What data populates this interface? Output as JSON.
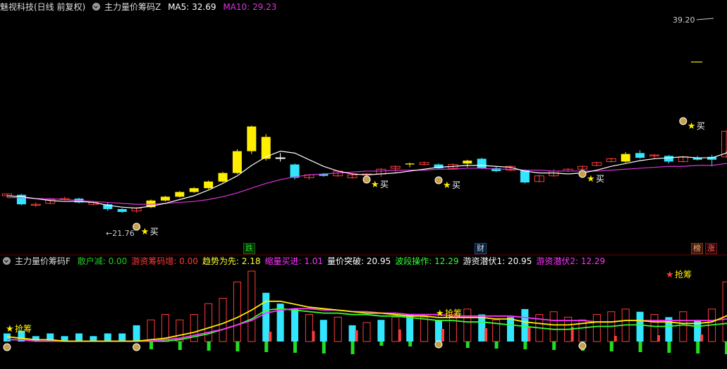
{
  "header_top": {
    "title": "魅视科技(日线 前复权)",
    "indicator": "主力量价筹码Z",
    "ma5_label": "MA5: 32.69",
    "ma10_label": "MA10: 29.23"
  },
  "header_bottom": {
    "indicator": "主力量价筹码F",
    "items": [
      {
        "label": "散户减: 0.00",
        "color": "#22cc22"
      },
      {
        "label": "游资筹码增: 0.00",
        "color": "#ff3b3b"
      },
      {
        "label": "趋势为先: 2.18",
        "color": "#ffff33"
      },
      {
        "label": "缩量买进: 1.01",
        "color": "#ff33ff"
      },
      {
        "label": "量价突破: 20.95",
        "color": "#ffffff"
      },
      {
        "label": "波段操作: 12.29",
        "color": "#33ff33"
      },
      {
        "label": "游资潜伏1: 20.95",
        "color": "#ffffff"
      },
      {
        "label": "游资潜伏2: 12.29",
        "color": "#ff33ff"
      }
    ]
  },
  "price_labels": {
    "high": "39.20",
    "low": "21.76"
  },
  "markers": {
    "buy": "买",
    "grab": "抢筹"
  },
  "tags": {
    "die": "跌",
    "cai": "财",
    "bang": "榜",
    "zhang": "涨"
  },
  "colors": {
    "up": "#ff3b3b",
    "down": "#33e6ff",
    "yellow": "#ffee00",
    "ma5": "#ffffff",
    "ma10": "#dd33dd"
  },
  "chart_data": {
    "type": "candlestick",
    "price_range": [
      19,
      42
    ],
    "candles": [
      {
        "o": 23.6,
        "h": 23.8,
        "l": 23.4,
        "c": 23.8,
        "s": "up"
      },
      {
        "o": 23.7,
        "h": 23.8,
        "l": 22.6,
        "c": 22.7,
        "s": "down"
      },
      {
        "o": 22.7,
        "h": 22.9,
        "l": 22.4,
        "c": 22.6,
        "s": "up"
      },
      {
        "o": 22.8,
        "h": 23.3,
        "l": 22.7,
        "c": 23.2,
        "s": "up"
      },
      {
        "o": 23.3,
        "h": 23.5,
        "l": 23.1,
        "c": 23.2,
        "s": "up"
      },
      {
        "o": 23.3,
        "h": 23.4,
        "l": 22.8,
        "c": 22.9,
        "s": "down"
      },
      {
        "o": 22.9,
        "h": 23.0,
        "l": 22.6,
        "c": 22.7,
        "s": "up"
      },
      {
        "o": 22.7,
        "h": 22.9,
        "l": 22.0,
        "c": 22.2,
        "s": "down"
      },
      {
        "o": 22.2,
        "h": 22.3,
        "l": 21.8,
        "c": 21.9,
        "s": "down"
      },
      {
        "o": 22.0,
        "h": 22.4,
        "l": 21.8,
        "c": 22.3,
        "s": "up"
      },
      {
        "o": 22.4,
        "h": 23.2,
        "l": 22.3,
        "c": 23.1,
        "s": "yellow"
      },
      {
        "o": 23.1,
        "h": 23.6,
        "l": 23.0,
        "c": 23.5,
        "s": "yellow"
      },
      {
        "o": 23.5,
        "h": 24.1,
        "l": 23.4,
        "c": 24.0,
        "s": "yellow"
      },
      {
        "o": 24.0,
        "h": 24.5,
        "l": 23.9,
        "c": 24.4,
        "s": "yellow"
      },
      {
        "o": 24.4,
        "h": 25.2,
        "l": 24.3,
        "c": 25.1,
        "s": "yellow"
      },
      {
        "o": 25.1,
        "h": 26.1,
        "l": 25.0,
        "c": 26.0,
        "s": "yellow"
      },
      {
        "o": 26.0,
        "h": 28.5,
        "l": 25.9,
        "c": 28.3,
        "s": "yellow"
      },
      {
        "o": 28.3,
        "h": 31.0,
        "l": 28.0,
        "c": 30.9,
        "s": "yellow"
      },
      {
        "o": 29.8,
        "h": 30.1,
        "l": 27.3,
        "c": 27.5,
        "s": "yellow"
      },
      {
        "o": 27.6,
        "h": 28.1,
        "l": 27.2,
        "c": 27.6,
        "s": "doji"
      },
      {
        "o": 26.9,
        "h": 27.0,
        "l": 25.3,
        "c": 25.5,
        "s": "down"
      },
      {
        "o": 25.5,
        "h": 25.9,
        "l": 25.3,
        "c": 25.8,
        "s": "up"
      },
      {
        "o": 25.9,
        "h": 26.0,
        "l": 25.6,
        "c": 25.7,
        "s": "down"
      },
      {
        "o": 25.7,
        "h": 26.3,
        "l": 25.6,
        "c": 26.2,
        "s": "up"
      },
      {
        "o": 25.5,
        "h": 26.0,
        "l": 25.4,
        "c": 25.8,
        "s": "up"
      },
      {
        "o": 25.8,
        "h": 26.0,
        "l": 25.6,
        "c": 25.9,
        "s": "up"
      },
      {
        "o": 25.9,
        "h": 26.5,
        "l": 25.6,
        "c": 26.4,
        "s": "up"
      },
      {
        "o": 26.5,
        "h": 26.8,
        "l": 26.0,
        "c": 26.7,
        "s": "up"
      },
      {
        "o": 26.9,
        "h": 27.1,
        "l": 26.6,
        "c": 27.0,
        "s": "yellow"
      },
      {
        "o": 27.1,
        "h": 27.2,
        "l": 26.8,
        "c": 26.9,
        "s": "up"
      },
      {
        "o": 26.9,
        "h": 27.0,
        "l": 26.4,
        "c": 26.5,
        "s": "down"
      },
      {
        "o": 26.5,
        "h": 27.0,
        "l": 26.4,
        "c": 26.9,
        "s": "up"
      },
      {
        "o": 27.0,
        "h": 27.4,
        "l": 26.6,
        "c": 27.3,
        "s": "yellow"
      },
      {
        "o": 27.5,
        "h": 27.6,
        "l": 26.4,
        "c": 26.5,
        "s": "down"
      },
      {
        "o": 26.5,
        "h": 26.7,
        "l": 26.1,
        "c": 26.2,
        "s": "down"
      },
      {
        "o": 26.3,
        "h": 26.8,
        "l": 26.2,
        "c": 26.7,
        "s": "up"
      },
      {
        "o": 26.3,
        "h": 26.4,
        "l": 24.9,
        "c": 25.0,
        "s": "down"
      },
      {
        "o": 25.1,
        "h": 25.8,
        "l": 25.0,
        "c": 25.7,
        "s": "up"
      },
      {
        "o": 25.7,
        "h": 26.4,
        "l": 25.6,
        "c": 26.2,
        "s": "up"
      },
      {
        "o": 26.2,
        "h": 26.5,
        "l": 26.1,
        "c": 26.4,
        "s": "up"
      },
      {
        "o": 26.4,
        "h": 26.8,
        "l": 26.3,
        "c": 26.7,
        "s": "up"
      },
      {
        "o": 26.8,
        "h": 27.2,
        "l": 26.7,
        "c": 27.1,
        "s": "up"
      },
      {
        "o": 27.2,
        "h": 27.6,
        "l": 27.1,
        "c": 27.5,
        "s": "up"
      },
      {
        "o": 27.2,
        "h": 28.2,
        "l": 27.1,
        "c": 28.0,
        "s": "yellow"
      },
      {
        "o": 28.1,
        "h": 28.4,
        "l": 27.5,
        "c": 27.6,
        "s": "down"
      },
      {
        "o": 27.8,
        "h": 28.0,
        "l": 27.5,
        "c": 27.9,
        "s": "up"
      },
      {
        "o": 27.8,
        "h": 27.9,
        "l": 27.0,
        "c": 27.2,
        "s": "down"
      },
      {
        "o": 27.2,
        "h": 27.8,
        "l": 27.1,
        "c": 27.7,
        "s": "up"
      },
      {
        "o": 27.6,
        "h": 27.8,
        "l": 27.3,
        "c": 27.4,
        "s": "down"
      },
      {
        "o": 27.4,
        "h": 27.9,
        "l": 26.7,
        "c": 27.7,
        "s": "down"
      },
      {
        "o": 27.7,
        "h": 30.5,
        "l": 27.6,
        "c": 30.4,
        "s": "up"
      },
      {
        "o": 35.0,
        "h": 37.2,
        "l": 34.8,
        "c": 35.5,
        "s": "doji"
      }
    ],
    "ma5": [
      23.6,
      23.5,
      23.3,
      23.1,
      23.0,
      23.0,
      22.9,
      22.6,
      22.4,
      22.3,
      22.5,
      22.8,
      23.2,
      23.6,
      24.2,
      24.9,
      25.7,
      26.8,
      27.7,
      28.3,
      28.1,
      27.4,
      26.7,
      26.2,
      25.9,
      25.8,
      25.9,
      26.0,
      26.2,
      26.4,
      26.6,
      26.7,
      26.8,
      26.8,
      26.7,
      26.6,
      26.2,
      26.0,
      26.0,
      25.9,
      26.0,
      26.3,
      26.7,
      27.0,
      27.3,
      27.5,
      27.6,
      27.7,
      27.6,
      27.6,
      28.1,
      30.5,
      32.7,
      35.5,
      38.0
    ],
    "ma10": [
      23.4,
      23.4,
      23.3,
      23.3,
      23.2,
      23.1,
      23.0,
      22.9,
      22.8,
      22.7,
      22.7,
      22.8,
      22.9,
      23.0,
      23.2,
      23.5,
      23.9,
      24.4,
      24.9,
      25.3,
      25.6,
      25.8,
      25.9,
      26.0,
      26.1,
      26.2,
      26.2,
      26.3,
      26.3,
      26.3,
      26.4,
      26.4,
      26.5,
      26.5,
      26.4,
      26.4,
      26.3,
      26.3,
      26.2,
      26.2,
      26.2,
      26.2,
      26.3,
      26.4,
      26.5,
      26.6,
      26.7,
      26.7,
      26.8,
      26.8,
      27.0,
      27.4,
      28.0,
      28.9,
      29.9
    ],
    "vol": [
      [
        0,
        3
      ],
      [
        0,
        4
      ],
      [
        0,
        2
      ],
      [
        0,
        3
      ],
      [
        0,
        2
      ],
      [
        0,
        3
      ],
      [
        0,
        2
      ],
      [
        0,
        3
      ],
      [
        0,
        3
      ],
      [
        0,
        6
      ],
      [
        1,
        8
      ],
      [
        1,
        10
      ],
      [
        1,
        8
      ],
      [
        1,
        10
      ],
      [
        1,
        14
      ],
      [
        1,
        16
      ],
      [
        1,
        22
      ],
      [
        1,
        26
      ],
      [
        0,
        18
      ],
      [
        0,
        14
      ],
      [
        0,
        12
      ],
      [
        1,
        10
      ],
      [
        0,
        8
      ],
      [
        1,
        9
      ],
      [
        0,
        6
      ],
      [
        1,
        7
      ],
      [
        0,
        8
      ],
      [
        1,
        9
      ],
      [
        0,
        10
      ],
      [
        1,
        9
      ],
      [
        0,
        8
      ],
      [
        1,
        10
      ],
      [
        1,
        12
      ],
      [
        0,
        10
      ],
      [
        1,
        8
      ],
      [
        0,
        9
      ],
      [
        0,
        12
      ],
      [
        1,
        10
      ],
      [
        1,
        11
      ],
      [
        1,
        9
      ],
      [
        1,
        8
      ],
      [
        1,
        10
      ],
      [
        1,
        11
      ],
      [
        1,
        12
      ],
      [
        0,
        11
      ],
      [
        1,
        10
      ],
      [
        0,
        9
      ],
      [
        1,
        11
      ],
      [
        0,
        8
      ],
      [
        1,
        12
      ],
      [
        1,
        22
      ],
      [
        1,
        20
      ],
      [
        1,
        16
      ]
    ],
    "oscA": [
      8,
      7,
      6,
      6,
      5,
      5,
      5,
      5,
      5,
      5,
      6,
      7,
      9,
      11,
      14,
      17,
      21,
      26,
      32,
      32,
      30,
      28,
      27,
      26,
      25,
      24,
      24,
      23,
      22,
      22,
      21,
      21,
      21,
      21,
      20,
      20,
      18,
      17,
      16,
      16,
      17,
      18,
      18,
      19,
      19,
      18,
      18,
      17,
      17,
      18,
      22,
      28,
      34,
      42,
      52
    ],
    "oscB": [
      6,
      6,
      5,
      5,
      5,
      5,
      5,
      5,
      5,
      5,
      5,
      6,
      7,
      9,
      11,
      13,
      16,
      19,
      24,
      26,
      27,
      27,
      26,
      26,
      25,
      25,
      24,
      24,
      23,
      23,
      23,
      22,
      22,
      22,
      22,
      22,
      21,
      20,
      19,
      19,
      19,
      18,
      18,
      19,
      19,
      19,
      19,
      19,
      19,
      19,
      20,
      22,
      25,
      29,
      34
    ],
    "oscC": [
      6,
      6,
      5,
      5,
      5,
      5,
      5,
      5,
      5,
      5,
      5,
      5,
      6,
      8,
      10,
      13,
      16,
      20,
      26,
      27,
      26,
      25,
      24,
      24,
      23,
      23,
      22,
      22,
      21,
      20,
      19,
      19,
      18,
      18,
      17,
      16,
      15,
      14,
      13,
      13,
      14,
      15,
      15,
      16,
      16,
      15,
      15,
      16,
      15,
      16,
      17,
      17,
      17,
      18,
      18
    ]
  }
}
